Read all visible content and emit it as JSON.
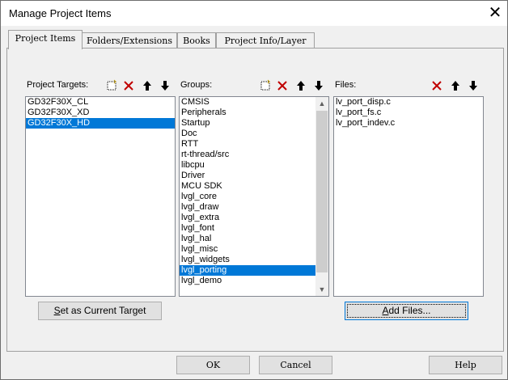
{
  "window": {
    "title": "Manage Project Items",
    "close_glyph": "✕"
  },
  "tabs": [
    {
      "label": "Project Items",
      "active": true
    },
    {
      "label": "Folders/Extensions",
      "active": false
    },
    {
      "label": "Books",
      "active": false
    },
    {
      "label": "Project Info/Layer",
      "active": false
    }
  ],
  "targets": {
    "label": "Project Targets:",
    "items": [
      "GD32F30X_CL",
      "GD32F30X_XD",
      "GD32F30X_HD"
    ],
    "selected": 2,
    "set_current_prefix": "S",
    "set_current_rest": "et as Current Target"
  },
  "groups": {
    "label": "Groups:",
    "items": [
      "CMSIS",
      "Peripherals",
      "Startup",
      "Doc",
      "RTT",
      "rt-thread/src",
      "libcpu",
      "Driver",
      "MCU SDK",
      "lvgl_core",
      "lvgl_draw",
      "lvgl_extra",
      "lvgl_font",
      "lvgl_hal",
      "lvgl_misc",
      "lvgl_widgets",
      "lvgl_porting",
      "lvgl_demo"
    ],
    "selected": 16
  },
  "files": {
    "label": "Files:",
    "items": [
      "lv_port_disp.c",
      "lv_port_fs.c",
      "lv_port_indev.c"
    ],
    "add_prefix": "A",
    "add_rest": "dd Files..."
  },
  "footer": {
    "ok": "OK",
    "cancel": "Cancel",
    "help": "Help"
  },
  "icons": {
    "new": "new-item-icon",
    "delete": "delete-icon",
    "up": "move-up-icon",
    "down": "move-down-icon"
  },
  "colors": {
    "selection": "#0078d7",
    "delete_red": "#c00000"
  }
}
